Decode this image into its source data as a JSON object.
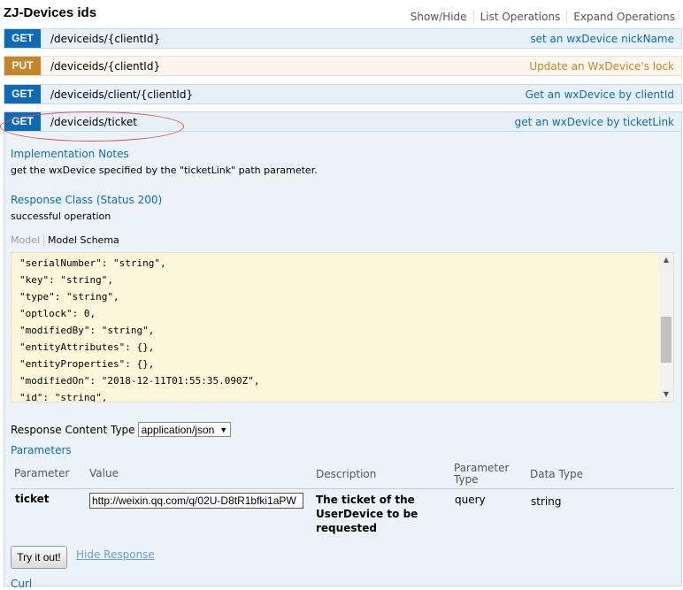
{
  "resource": {
    "title": "ZJ-Devices ids",
    "links": [
      "Show/Hide",
      "List Operations",
      "Expand Operations"
    ]
  },
  "operations": [
    {
      "method": "GET",
      "path": "/deviceids/{clientId}",
      "summary": "set an wxDevice nickName"
    },
    {
      "method": "PUT",
      "path": "/deviceids/{clientId}",
      "summary": "Update an WxDevice's lock"
    },
    {
      "method": "GET",
      "path": "/deviceids/client/{clientId}",
      "summary": "Get an wxDevice by clientId"
    },
    {
      "method": "GET",
      "path": "/deviceids/ticket",
      "summary": "get an wxDevice by ticketLink"
    }
  ],
  "details": {
    "impl_title": "Implementation Notes",
    "impl_text": "get the wxDevice specified by the \"ticketLink\" path parameter.",
    "resp_title": "Response Class (Status 200)",
    "resp_text": "successful operation",
    "tab_model": "Model",
    "tab_schema": "Model Schema",
    "schema_lines": [
      "\"serialNumber\": \"string\",",
      "\"key\": \"string\",",
      "\"type\": \"string\",",
      "\"optlock\": 0,",
      "\"modifiedBy\": \"string\",",
      "\"entityAttributes\": {},",
      "\"entityProperties\": {},",
      "\"modifiedOn\": \"2018-12-11T01:55:35.090Z\",",
      "\"id\": \"string\","
    ],
    "response_content_type_label": "Response Content Type",
    "response_content_type_value": "application/json",
    "params_title": "Parameters",
    "param_headers": {
      "parameter": "Parameter",
      "value": "Value",
      "description": "Description",
      "param_type_1": "Parameter",
      "param_type_2": "Type",
      "data_type": "Data Type"
    },
    "param_row": {
      "name": "ticket",
      "value": "http://weixin.qq.com/q/02U-D8tR1bfki1aPW",
      "description_1": "The ticket of the",
      "description_2": "UserDevice to be",
      "description_3": "requested",
      "param_type": "query",
      "data_type": "string"
    },
    "try_button": "Try it out!",
    "hide_response": "Hide Response",
    "curl_title": "Curl"
  },
  "colors": {
    "get_accent": "#0f6ab4",
    "put_accent": "#c5862b",
    "annotation": "#d9534f"
  }
}
